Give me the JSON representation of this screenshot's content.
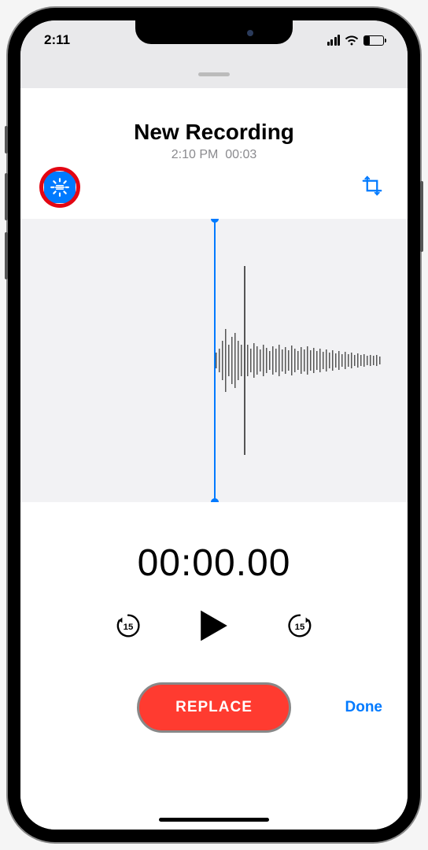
{
  "status": {
    "time": "2:11"
  },
  "recording": {
    "title": "New Recording",
    "timestamp": "2:10 PM",
    "duration": "00:03"
  },
  "playback": {
    "position": "00:00.00",
    "skip_seconds": "15"
  },
  "actions": {
    "replace": "REPLACE",
    "done": "Done"
  },
  "icons": {
    "enhance": "enhance-icon",
    "trim": "trim-icon",
    "skip_back": "skip-back-15-icon",
    "play": "play-icon",
    "skip_forward": "skip-forward-15-icon"
  }
}
